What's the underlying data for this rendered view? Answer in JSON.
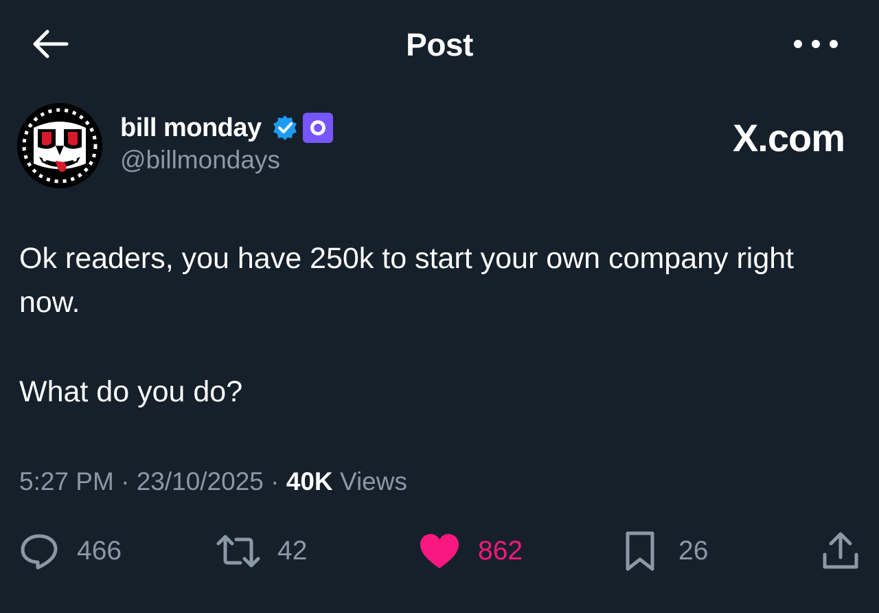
{
  "header": {
    "title": "Post"
  },
  "author": {
    "name": "bill monday",
    "handle": "@billmondays",
    "verified_icon": "verified-badge-icon",
    "affiliate_icon": "affiliate-badge-icon"
  },
  "site_label": "X.com",
  "post": {
    "paragraph_1": "Ok readers, you have 250k to start your own company right now.",
    "paragraph_2": "What do you do?"
  },
  "meta": {
    "time": "5:27 PM",
    "separator": "·",
    "date": "23/10/2025",
    "views_count": "40K",
    "views_label": "Views"
  },
  "actions": {
    "replies": "466",
    "reposts": "42",
    "likes": "862",
    "bookmarks": "26"
  },
  "colors": {
    "background": "#15202b",
    "text": "#ffffff",
    "muted": "#8b98a5",
    "like": "#f91880",
    "verified": "#1d9bf0",
    "affiliate": "#7856ff"
  }
}
